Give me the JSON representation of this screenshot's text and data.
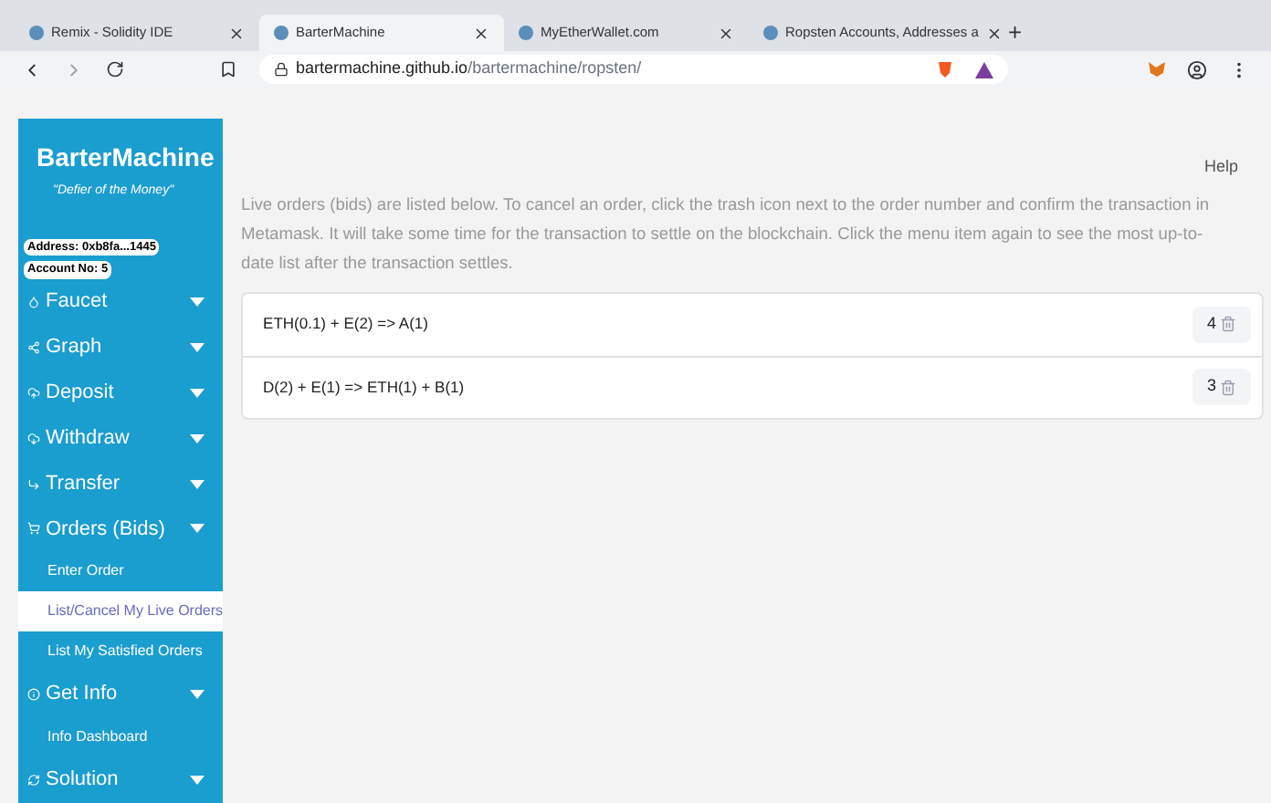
{
  "browser": {
    "tabs": [
      {
        "title": "Remix - Solidity IDE",
        "selected": false
      },
      {
        "title": "BarterMachine",
        "selected": true
      },
      {
        "title": "MyEtherWallet.com",
        "selected": false
      },
      {
        "title": "Ropsten Accounts, Addresses a",
        "selected": false
      }
    ],
    "new_tab": "+",
    "url_host": "bartermachine.github.io",
    "url_path": "/bartermachine/ropsten/"
  },
  "sidebar": {
    "title": "BarterMachine",
    "subtitle": "\"Defier of the Money\"",
    "address": "Address: 0xb8fa...1445",
    "account": "Account No: 5",
    "items": [
      {
        "kind": "section",
        "label": "Faucet",
        "selected": false
      },
      {
        "kind": "section",
        "label": "Graph",
        "selected": false
      },
      {
        "kind": "section",
        "label": "Deposit",
        "selected": false
      },
      {
        "kind": "section",
        "label": "Withdraw",
        "selected": false
      },
      {
        "kind": "section",
        "label": "Transfer",
        "selected": false
      },
      {
        "kind": "section",
        "label": "Orders (Bids)",
        "selected": false
      },
      {
        "kind": "link",
        "label": "Enter Order",
        "selected": false
      },
      {
        "kind": "link",
        "label": "List/Cancel My Live Orders",
        "selected": true
      },
      {
        "kind": "link",
        "label": "List My Satisfied Orders",
        "selected": false
      },
      {
        "kind": "section",
        "label": "Get Info",
        "selected": false
      },
      {
        "kind": "link",
        "label": "Info Dashboard",
        "selected": false
      },
      {
        "kind": "section",
        "label": "Solution",
        "selected": false
      }
    ]
  },
  "main": {
    "help": "Help",
    "intro": "Live orders (bids) are listed below. To cancel an order, click the trash icon next to the order number and confirm the transaction in Metamask. It will take some time for the transaction to settle on the blockchain. Click the menu item again to see the most up-to-date list after the transaction settles.",
    "orders": [
      {
        "text": "ETH(0.1) + E(2) => A(1)",
        "number": "4"
      },
      {
        "text": "D(2) + E(1) => ETH(1) + B(1)",
        "number": "3"
      }
    ]
  }
}
